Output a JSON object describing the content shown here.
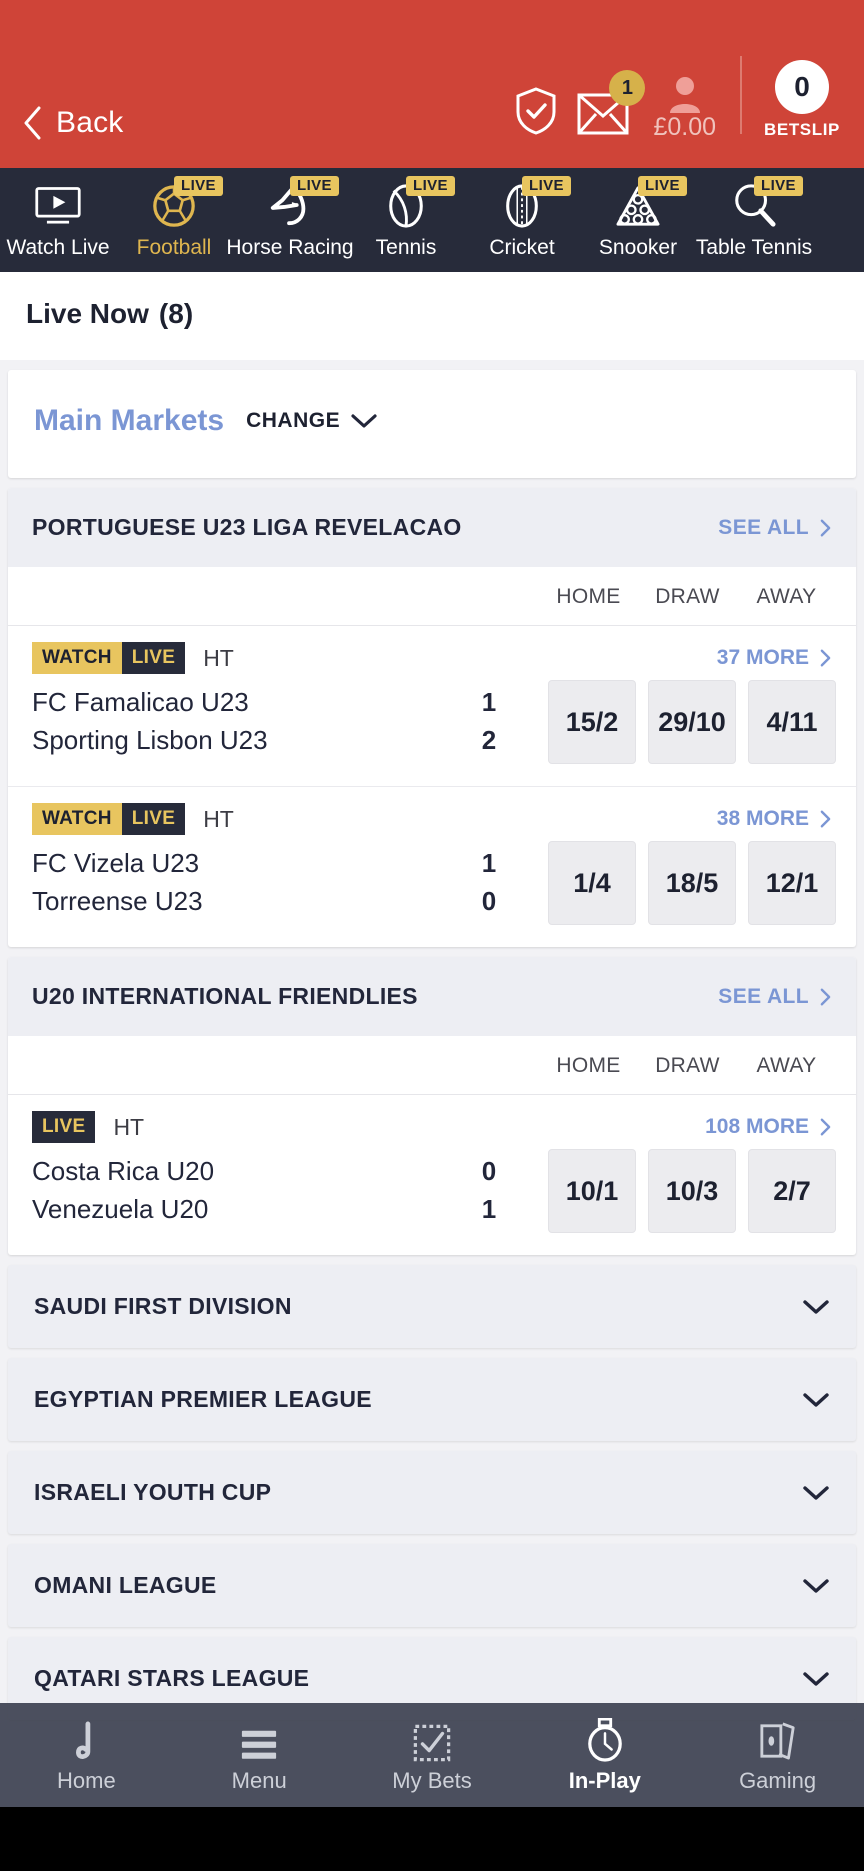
{
  "header": {
    "back_label": "Back",
    "shield_icon": "shield-check-icon",
    "mail_icon": "envelope-icon",
    "mail_badge": "1",
    "account_icon": "user-icon",
    "balance": "£0.00",
    "betslip_count": "0",
    "betslip_label": "BETSLIP",
    "accent_color": "#cf4438"
  },
  "sports_nav": [
    {
      "label": "Watch Live",
      "icon": "watch-live-icon",
      "live": false,
      "active": false
    },
    {
      "label": "Football",
      "icon": "football-icon",
      "live": true,
      "live_label": "LIVE",
      "active": true
    },
    {
      "label": "Horse Racing",
      "icon": "horse-racing-icon",
      "live": true,
      "live_label": "LIVE",
      "active": false
    },
    {
      "label": "Tennis",
      "icon": "tennis-icon",
      "live": true,
      "live_label": "LIVE",
      "active": false
    },
    {
      "label": "Cricket",
      "icon": "cricket-icon",
      "live": true,
      "live_label": "LIVE",
      "active": false
    },
    {
      "label": "Snooker",
      "icon": "snooker-icon",
      "live": true,
      "live_label": "LIVE",
      "active": false
    },
    {
      "label": "Table Tennis",
      "icon": "table-tennis-icon",
      "live": true,
      "live_label": "LIVE",
      "active": false
    }
  ],
  "live_now": {
    "title": "Live Now",
    "count": "(8)"
  },
  "market_selector": {
    "title": "Main Markets",
    "change_label": "CHANGE",
    "chevron": "chevron-down-icon"
  },
  "column_headers": [
    "HOME",
    "DRAW",
    "AWAY"
  ],
  "leagues": [
    {
      "name": "PORTUGUESE U23 LIGA REVELACAO",
      "see_all": "SEE ALL",
      "expanded": true,
      "matches": [
        {
          "watch_badge": "WATCH",
          "live_badge": "LIVE",
          "status": "HT",
          "more": "37 MORE",
          "home_team": "FC Famalicao U23",
          "away_team": "Sporting Lisbon U23",
          "home_score": "1",
          "away_score": "2",
          "odds": [
            "15/2",
            "29/10",
            "4/11"
          ]
        },
        {
          "watch_badge": "WATCH",
          "live_badge": "LIVE",
          "status": "HT",
          "more": "38 MORE",
          "home_team": "FC Vizela U23",
          "away_team": "Torreense U23",
          "home_score": "1",
          "away_score": "0",
          "odds": [
            "1/4",
            "18/5",
            "12/1"
          ]
        }
      ]
    },
    {
      "name": "U20 INTERNATIONAL FRIENDLIES",
      "see_all": "SEE ALL",
      "expanded": true,
      "matches": [
        {
          "watch_badge": "",
          "live_badge": "LIVE",
          "status": "HT",
          "more": "108 MORE",
          "home_team": "Costa Rica U20",
          "away_team": "Venezuela U20",
          "home_score": "0",
          "away_score": "1",
          "odds": [
            "10/1",
            "10/3",
            "2/7"
          ]
        }
      ]
    }
  ],
  "collapsed_leagues": [
    {
      "name": "SAUDI FIRST DIVISION",
      "chevron": "chevron-down-icon"
    },
    {
      "name": "EGYPTIAN PREMIER LEAGUE",
      "chevron": "chevron-down-icon"
    },
    {
      "name": "ISRAELI YOUTH CUP",
      "chevron": "chevron-down-icon"
    },
    {
      "name": "OMANI LEAGUE",
      "chevron": "chevron-down-icon"
    },
    {
      "name": "QATARI STARS LEAGUE",
      "chevron": "chevron-down-icon"
    }
  ],
  "bottom_nav": [
    {
      "label": "Home",
      "icon": "home-icon",
      "active": false
    },
    {
      "label": "Menu",
      "icon": "hamburger-menu-icon",
      "active": false
    },
    {
      "label": "My Bets",
      "icon": "my-bets-check-icon",
      "active": false
    },
    {
      "label": "In-Play",
      "icon": "stopwatch-icon",
      "active": true
    },
    {
      "label": "Gaming",
      "icon": "cards-icon",
      "active": false
    }
  ]
}
